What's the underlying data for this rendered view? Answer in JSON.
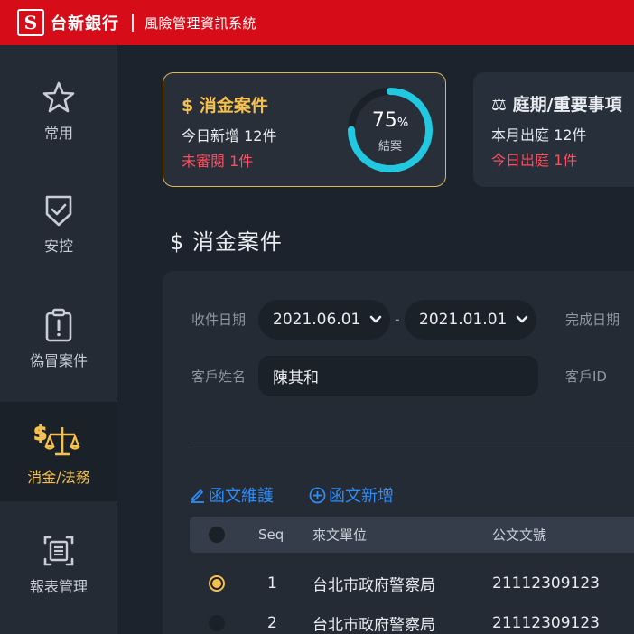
{
  "topbar": {
    "logo_glyph": "S",
    "brand": "台新銀行",
    "system_name": "風險管理資訊系統"
  },
  "sidebar": {
    "items": [
      {
        "label": "常用",
        "icon": "star-icon"
      },
      {
        "label": "安控",
        "icon": "shield-check-icon"
      },
      {
        "label": "偽冒案件",
        "icon": "alert-clipboard-icon"
      },
      {
        "label": "消金/法務",
        "icon": "scales-dollar-icon",
        "active": true
      },
      {
        "label": "報表管理",
        "icon": "report-icon"
      }
    ]
  },
  "cards": {
    "consumer": {
      "title": "$ 消金案件",
      "line1": "今日新增 12件",
      "line2": "未審閱 1件",
      "percent": "75",
      "percent_unit": "%",
      "ring_label": "結案",
      "progress": 0.75
    },
    "court": {
      "title": "⚖ 庭期/重要事項",
      "line1": "本月出庭 12件",
      "line2": "今日出庭 1件"
    }
  },
  "section": {
    "title": "$ 消金案件"
  },
  "filters": {
    "received_date_label": "收件日期",
    "date_from": "2021.06.01",
    "date_sep": "-",
    "date_to": "2021.01.01",
    "completed_date_label": "完成日期",
    "customer_name_label": "客戶姓名",
    "customer_name_value": "陳其和",
    "customer_id_label": "客戶ID"
  },
  "actions": {
    "maintain": "函文維護",
    "add": "函文新增"
  },
  "table": {
    "headers": {
      "seq": "Seq",
      "unit": "來文單位",
      "doc_no": "公文文號"
    },
    "rows": [
      {
        "seq": "1",
        "unit": "台北市政府警察局",
        "doc_no": "21112309123",
        "selected": true
      },
      {
        "seq": "2",
        "unit": "台北市政府警察局",
        "doc_no": "21112309123",
        "selected": false
      }
    ]
  },
  "colors": {
    "brand_red": "#d60c18",
    "accent_gold": "#f6c04c",
    "alert_red": "#ff4d5e",
    "link_blue": "#2f8cf5",
    "ring_cyan": "#22c7e0"
  }
}
